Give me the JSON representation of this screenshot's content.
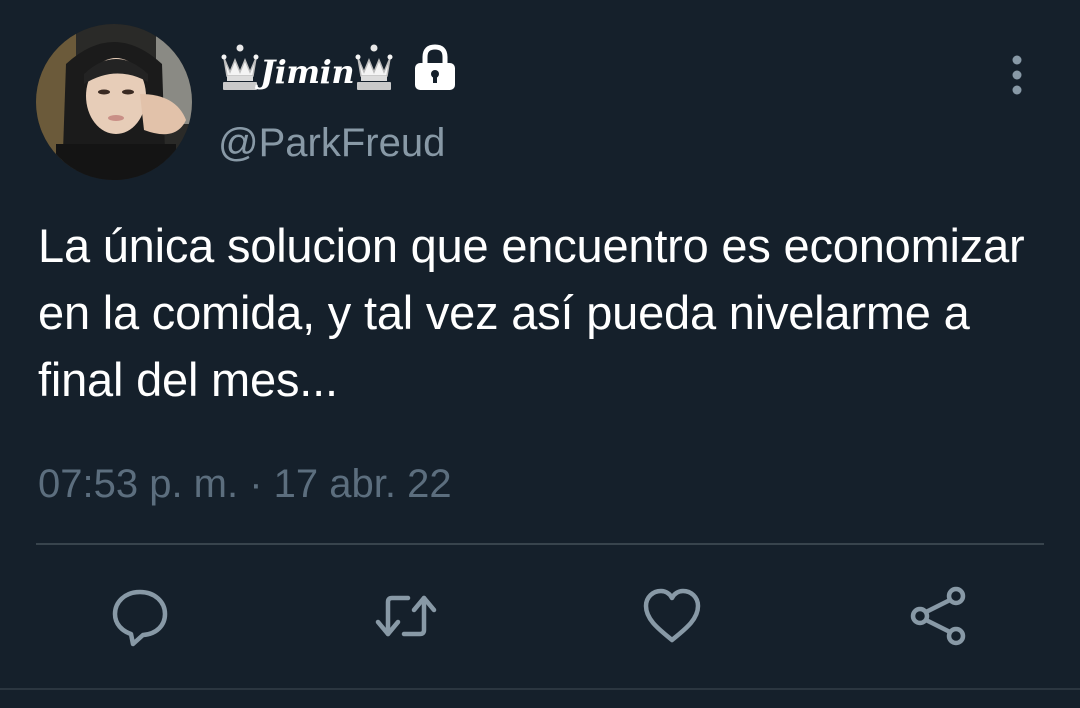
{
  "user": {
    "display_name": "Jimin",
    "handle": "@ParkFreud",
    "protected": true,
    "name_icons": [
      "chess-queen-icon",
      "chess-queen-icon",
      "lock-icon"
    ]
  },
  "tweet": {
    "text": "La única solucion que encuentro es economizar en la comida, y tal vez así pueda nivelarme a final del mes...",
    "timestamp": "07:53 p. m. · 17 abr. 22"
  },
  "actions": [
    {
      "name": "reply",
      "icon": "comment-icon"
    },
    {
      "name": "retweet",
      "icon": "retweet-icon"
    },
    {
      "name": "like",
      "icon": "heart-icon"
    },
    {
      "name": "share",
      "icon": "share-icon"
    }
  ],
  "colors": {
    "background": "#15202b",
    "primary_text": "#ffffff",
    "secondary_text": "#8899a6",
    "icon": "#8899a6",
    "divider": "#38444d"
  }
}
